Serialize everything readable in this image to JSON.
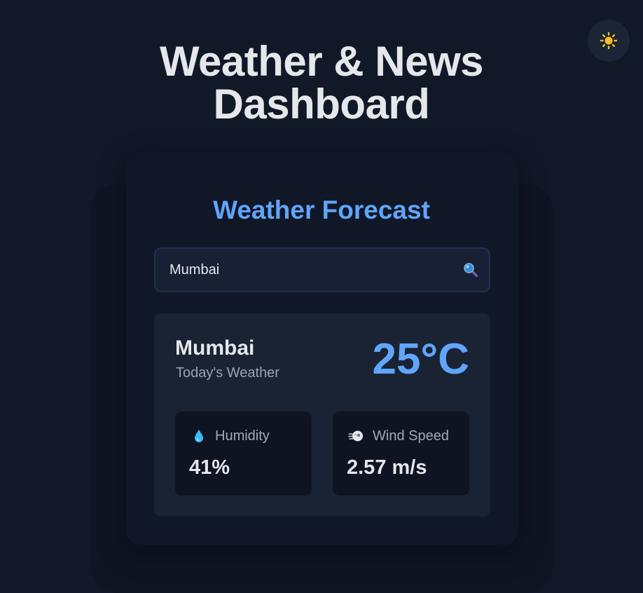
{
  "page": {
    "title_line1": "Weather & News",
    "title_line2": "Dashboard"
  },
  "theme_toggle": {
    "icon": "sun-icon",
    "color": "#fbbf24"
  },
  "weather": {
    "heading": "Weather Forecast",
    "search": {
      "value": "Mumbai",
      "icon": "search-icon"
    },
    "city": "Mumbai",
    "subtitle": "Today's Weather",
    "temperature": "25°C",
    "stats": [
      {
        "icon": "water-drop-icon",
        "label": "Humidity",
        "value": "41%"
      },
      {
        "icon": "wind-icon",
        "label": "Wind Speed",
        "value": "2.57 m/s"
      }
    ]
  },
  "colors": {
    "accent": "#60a5fa",
    "background": "#111827",
    "text": "#e5e7eb"
  }
}
